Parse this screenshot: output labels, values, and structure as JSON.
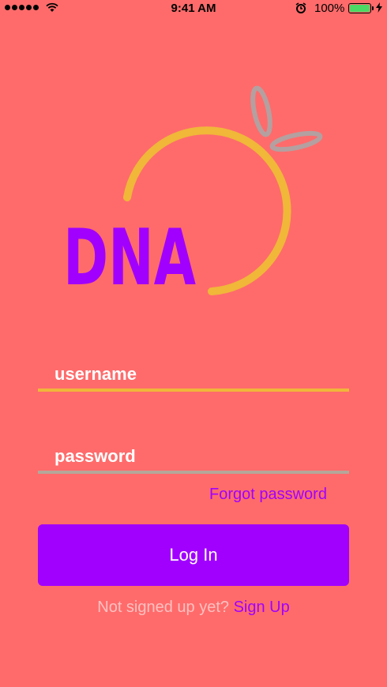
{
  "status_bar": {
    "time": "9:41 AM",
    "battery_percent": "100%",
    "icons": [
      "signal-dots-icon",
      "wifi-icon",
      "alarm-icon",
      "battery-icon",
      "charging-bolt-icon"
    ]
  },
  "logo": {
    "text": "DNA",
    "colors": {
      "text": "#a100ff",
      "ring": "#f0b739",
      "leaf": "#b4a0a0"
    }
  },
  "form": {
    "username_placeholder": "username",
    "username_value": "",
    "password_placeholder": "password",
    "password_value": "",
    "forgot_label": "Forgot password",
    "login_label": "Log In"
  },
  "footer": {
    "prompt": "Not signed up yet?",
    "signup_label": "Sign Up"
  },
  "colors": {
    "background": "#ff6b6b",
    "accent": "#a100ff",
    "username_underline": "#f0b739",
    "password_underline": "#b4a79a"
  }
}
